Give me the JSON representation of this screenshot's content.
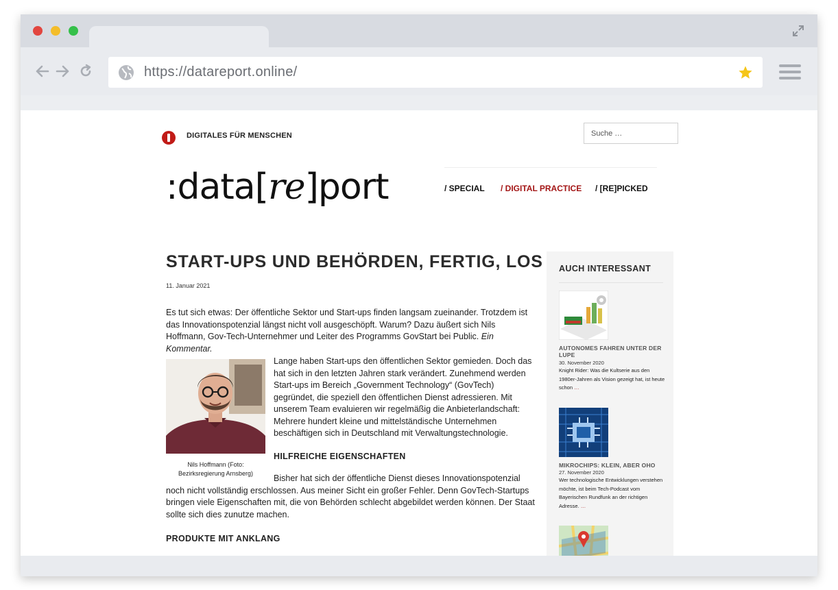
{
  "browser": {
    "url": "https://datareport.online/"
  },
  "site": {
    "tagline": "DIGITALES FÜR MENSCHEN",
    "search_placeholder": "Suche …",
    "logo_prefix": ":data[",
    "logo_re": "re",
    "logo_suffix": "]port",
    "nav": {
      "special": "/ SPECIAL",
      "digital_practice": "/ DIGITAL PRACTICE",
      "repicked": "/ [RE]PICKED"
    },
    "accent_color": "#a31515"
  },
  "article": {
    "title": "START-UPS UND BEHÖRDEN, FERTIG, LOS",
    "date": "11. Januar 2021",
    "intro": "Es tut sich etwas: Der öffentliche Sektor und Start-ups finden langsam zueinander. Trotzdem ist das Innovationspotenzial längst nicht voll ausgeschöpft. Warum? Dazu äußert sich Nils Hoffmann, Gov-Tech-Unternehmer und Leiter des Programms GovStart bei Public.",
    "intro_em": "Ein Kommentar.",
    "image_caption": "Nils Hoffmann (Foto: Bezirksregierung Arnsberg)",
    "paragraph1": "Lange haben Start-ups den öffentlichen Sektor gemieden. Doch das hat sich in den letzten Jahren stark verändert. Zunehmend werden Start-ups im Bereich „Government Technology“ (GovTech) gegründet, die speziell den öffentlichen Dienst adressieren. Mit unserem Team evaluieren wir regelmäßig die Anbieterlandschaft: Mehrere hundert kleine und mittelständische Unternehmen beschäftigen sich in Deutschland mit Verwaltungstechnologie.",
    "heading1": "HILFREICHE EIGENSCHAFTEN",
    "paragraph2": "Bisher hat sich der öffentliche Dienst dieses Innovationspotenzial noch nicht vollständig erschlossen. Aus meiner Sicht ein großer Fehler. Denn GovTech-Startups bringen viele Eigenschaften mit, die von Behörden schlecht abgebildet werden können. Der Staat sollte sich dies zunutze machen.",
    "heading2": "PRODUKTE MIT ANKLANG"
  },
  "sidebar": {
    "title": "AUCH INTERESSANT",
    "posts": [
      {
        "title": "AUTONOMES FAHREN UNTER DER LUPE",
        "date": "30. November 2020",
        "excerpt": "Knight Rider: Was die Kultserie aus den 1980er-Jahren als Vision gezeigt hat, ist heute schon",
        "more": "…"
      },
      {
        "title": "MIKROCHIPS: KLEIN, ABER OHO",
        "date": "27. November 2020",
        "excerpt": "Wer technologische Entwicklungen verstehen möchte, ist beim Tech-Podcast vom Bayerischen Rundfunk an der richtigen Adresse.",
        "more": "…"
      }
    ]
  }
}
